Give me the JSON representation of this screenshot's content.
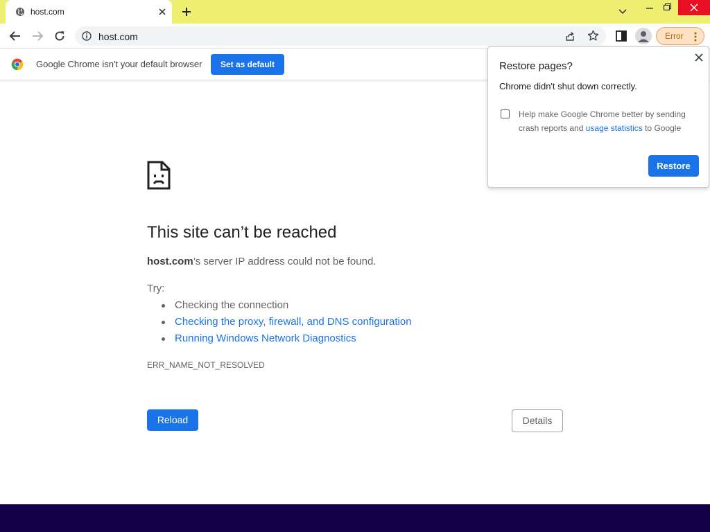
{
  "tab": {
    "title": "host.com"
  },
  "toolbar": {
    "url": "host.com",
    "error_chip": "Error"
  },
  "infobar": {
    "message": "Google Chrome isn't your default browser",
    "button": "Set as default"
  },
  "error_page": {
    "title": "This site can’t be reached",
    "host": "host.com",
    "description_suffix": "’s server IP address could not be found.",
    "try_label": "Try:",
    "suggestions": [
      "Checking the connection",
      "Checking the proxy, firewall, and DNS configuration",
      "Running Windows Network Diagnostics"
    ],
    "error_code": "ERR_NAME_NOT_RESOLVED",
    "reload_label": "Reload",
    "details_label": "Details"
  },
  "restore_popup": {
    "title": "Restore pages?",
    "message": "Chrome didn't shut down correctly.",
    "checkbox_text_before": "Help make Google Chrome better by sending crash reports and ",
    "checkbox_link": "usage statistics",
    "checkbox_text_after": " to Google",
    "checkbox_checked": false,
    "restore_label": "Restore"
  },
  "colors": {
    "accent": "#1a73e8",
    "tabstrip": "#eeee70",
    "taskbar": "#12004a",
    "error_chip_bg": "#fde2c4"
  }
}
